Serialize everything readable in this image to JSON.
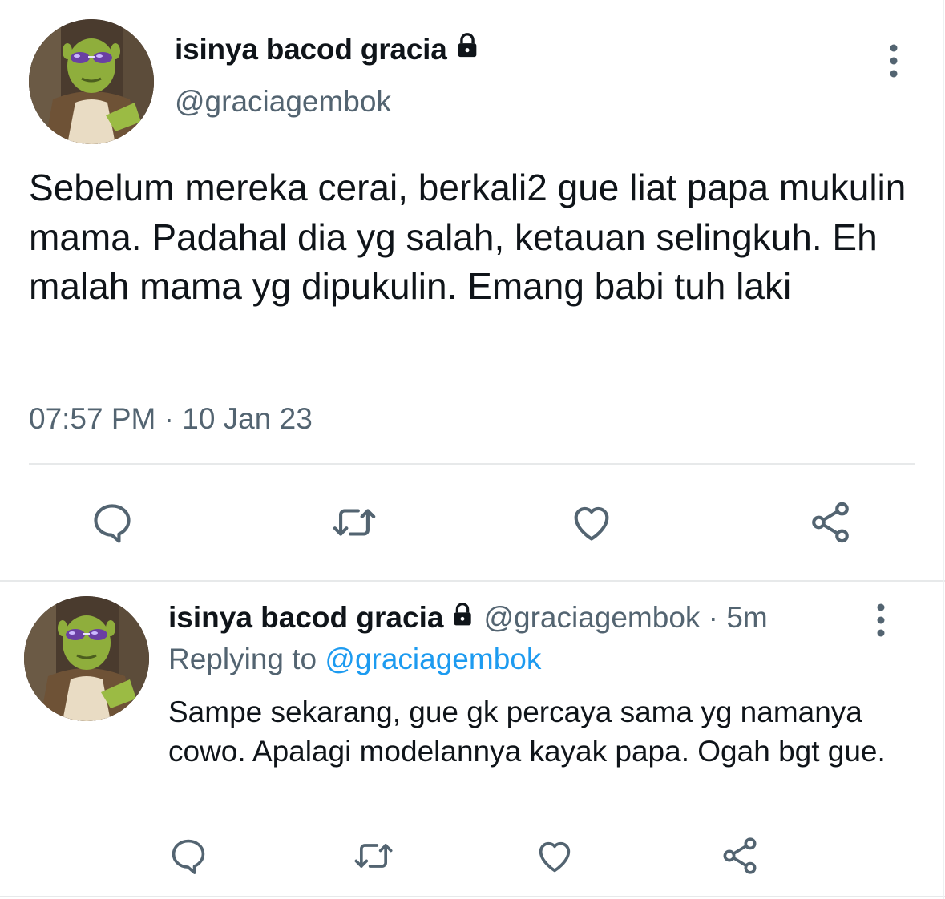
{
  "main_tweet": {
    "display_name": "isinya bacod gracia",
    "handle": "@graciagembok",
    "text": "Sebelum mereka cerai, berkali2 gue liat papa mukulin mama. Padahal dia yg salah, ketauan selingkuh. Eh malah mama yg dipukulin. Emang babi tuh laki",
    "timestamp": "07:57 PM · 10 Jan 23",
    "actions": [
      "reply-icon",
      "retweet-icon",
      "like-icon",
      "share-icon"
    ]
  },
  "reply_tweet": {
    "display_name": "isinya bacod gracia",
    "meta": "@graciagembok · 5m",
    "replying_prefix": "Replying to ",
    "replying_mention": "@graciagembok",
    "text": "Sampe sekarang, gue gk percaya sama yg namanya cowo. Apalagi modelannya kayak papa. Ogah bgt gue.",
    "actions": [
      "reply-icon",
      "retweet-icon",
      "like-icon",
      "share-icon"
    ]
  },
  "colors": {
    "text_primary": "#0f1419",
    "text_secondary": "#536471",
    "link": "#1d9bf0",
    "divider": "#e7e9ea"
  }
}
